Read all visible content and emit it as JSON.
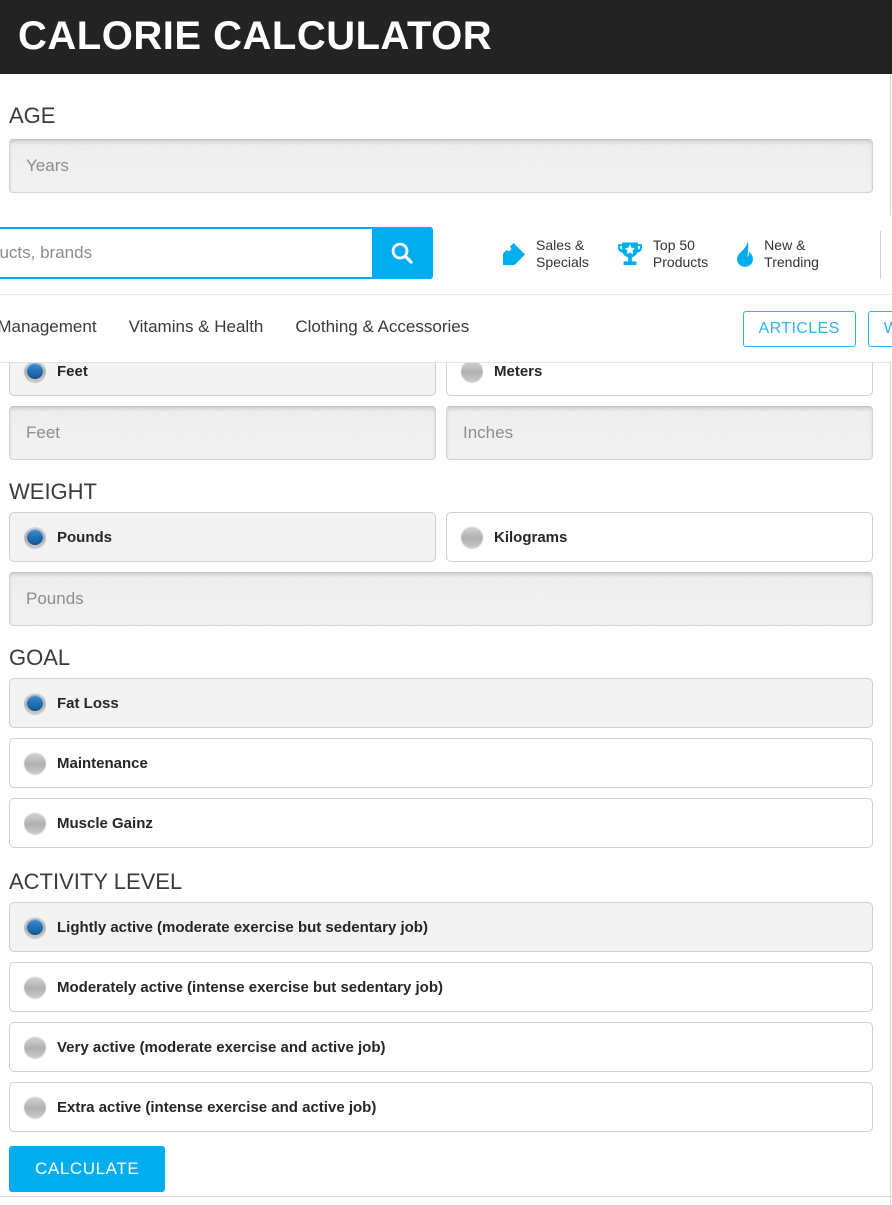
{
  "header": {
    "title": "CALORIE CALCULATOR"
  },
  "nav": {
    "search": {
      "placeholder": ", products, brands",
      "icon": "search-icon"
    },
    "quicklinks": [
      {
        "label": "Sales &\nSpecials",
        "icon": "tag-icon"
      },
      {
        "label": "Top 50\nProducts",
        "icon": "trophy-icon"
      },
      {
        "label": "New &\nTrending",
        "icon": "flame-icon"
      }
    ],
    "menu": [
      "Weight Management",
      "Vitamins & Health",
      "Clothing & Accessories"
    ],
    "pills": [
      "ARTICLES",
      "WOR"
    ]
  },
  "form": {
    "age": {
      "label": "AGE",
      "placeholder": "Years",
      "value": ""
    },
    "height": {
      "units": [
        {
          "label": "Feet",
          "selected": true
        },
        {
          "label": "Meters",
          "selected": false
        }
      ],
      "fields": [
        {
          "placeholder": "Feet",
          "value": ""
        },
        {
          "placeholder": "Inches",
          "value": ""
        }
      ]
    },
    "weight": {
      "label": "WEIGHT",
      "units": [
        {
          "label": "Pounds",
          "selected": true
        },
        {
          "label": "Kilograms",
          "selected": false
        }
      ],
      "field": {
        "placeholder": "Pounds",
        "value": ""
      }
    },
    "goal": {
      "label": "GOAL",
      "options": [
        {
          "label": "Fat Loss",
          "selected": true
        },
        {
          "label": "Maintenance",
          "selected": false
        },
        {
          "label": "Muscle Gainz",
          "selected": false
        }
      ]
    },
    "activity": {
      "label": "ACTIVITY LEVEL",
      "options": [
        {
          "label": "Lightly active (moderate exercise but sedentary job)",
          "selected": true
        },
        {
          "label": "Moderately active (intense exercise but sedentary job)",
          "selected": false
        },
        {
          "label": "Very active (moderate exercise and active job)",
          "selected": false
        },
        {
          "label": "Extra active (intense exercise and active job)",
          "selected": false
        }
      ]
    },
    "submit": {
      "label": "CALCULATE"
    }
  },
  "colors": {
    "brand_blue": "#00AEEF",
    "pill_blue": "#29B6F0",
    "header_dark": "#232323",
    "radio_blue": "#1F6FB5"
  }
}
